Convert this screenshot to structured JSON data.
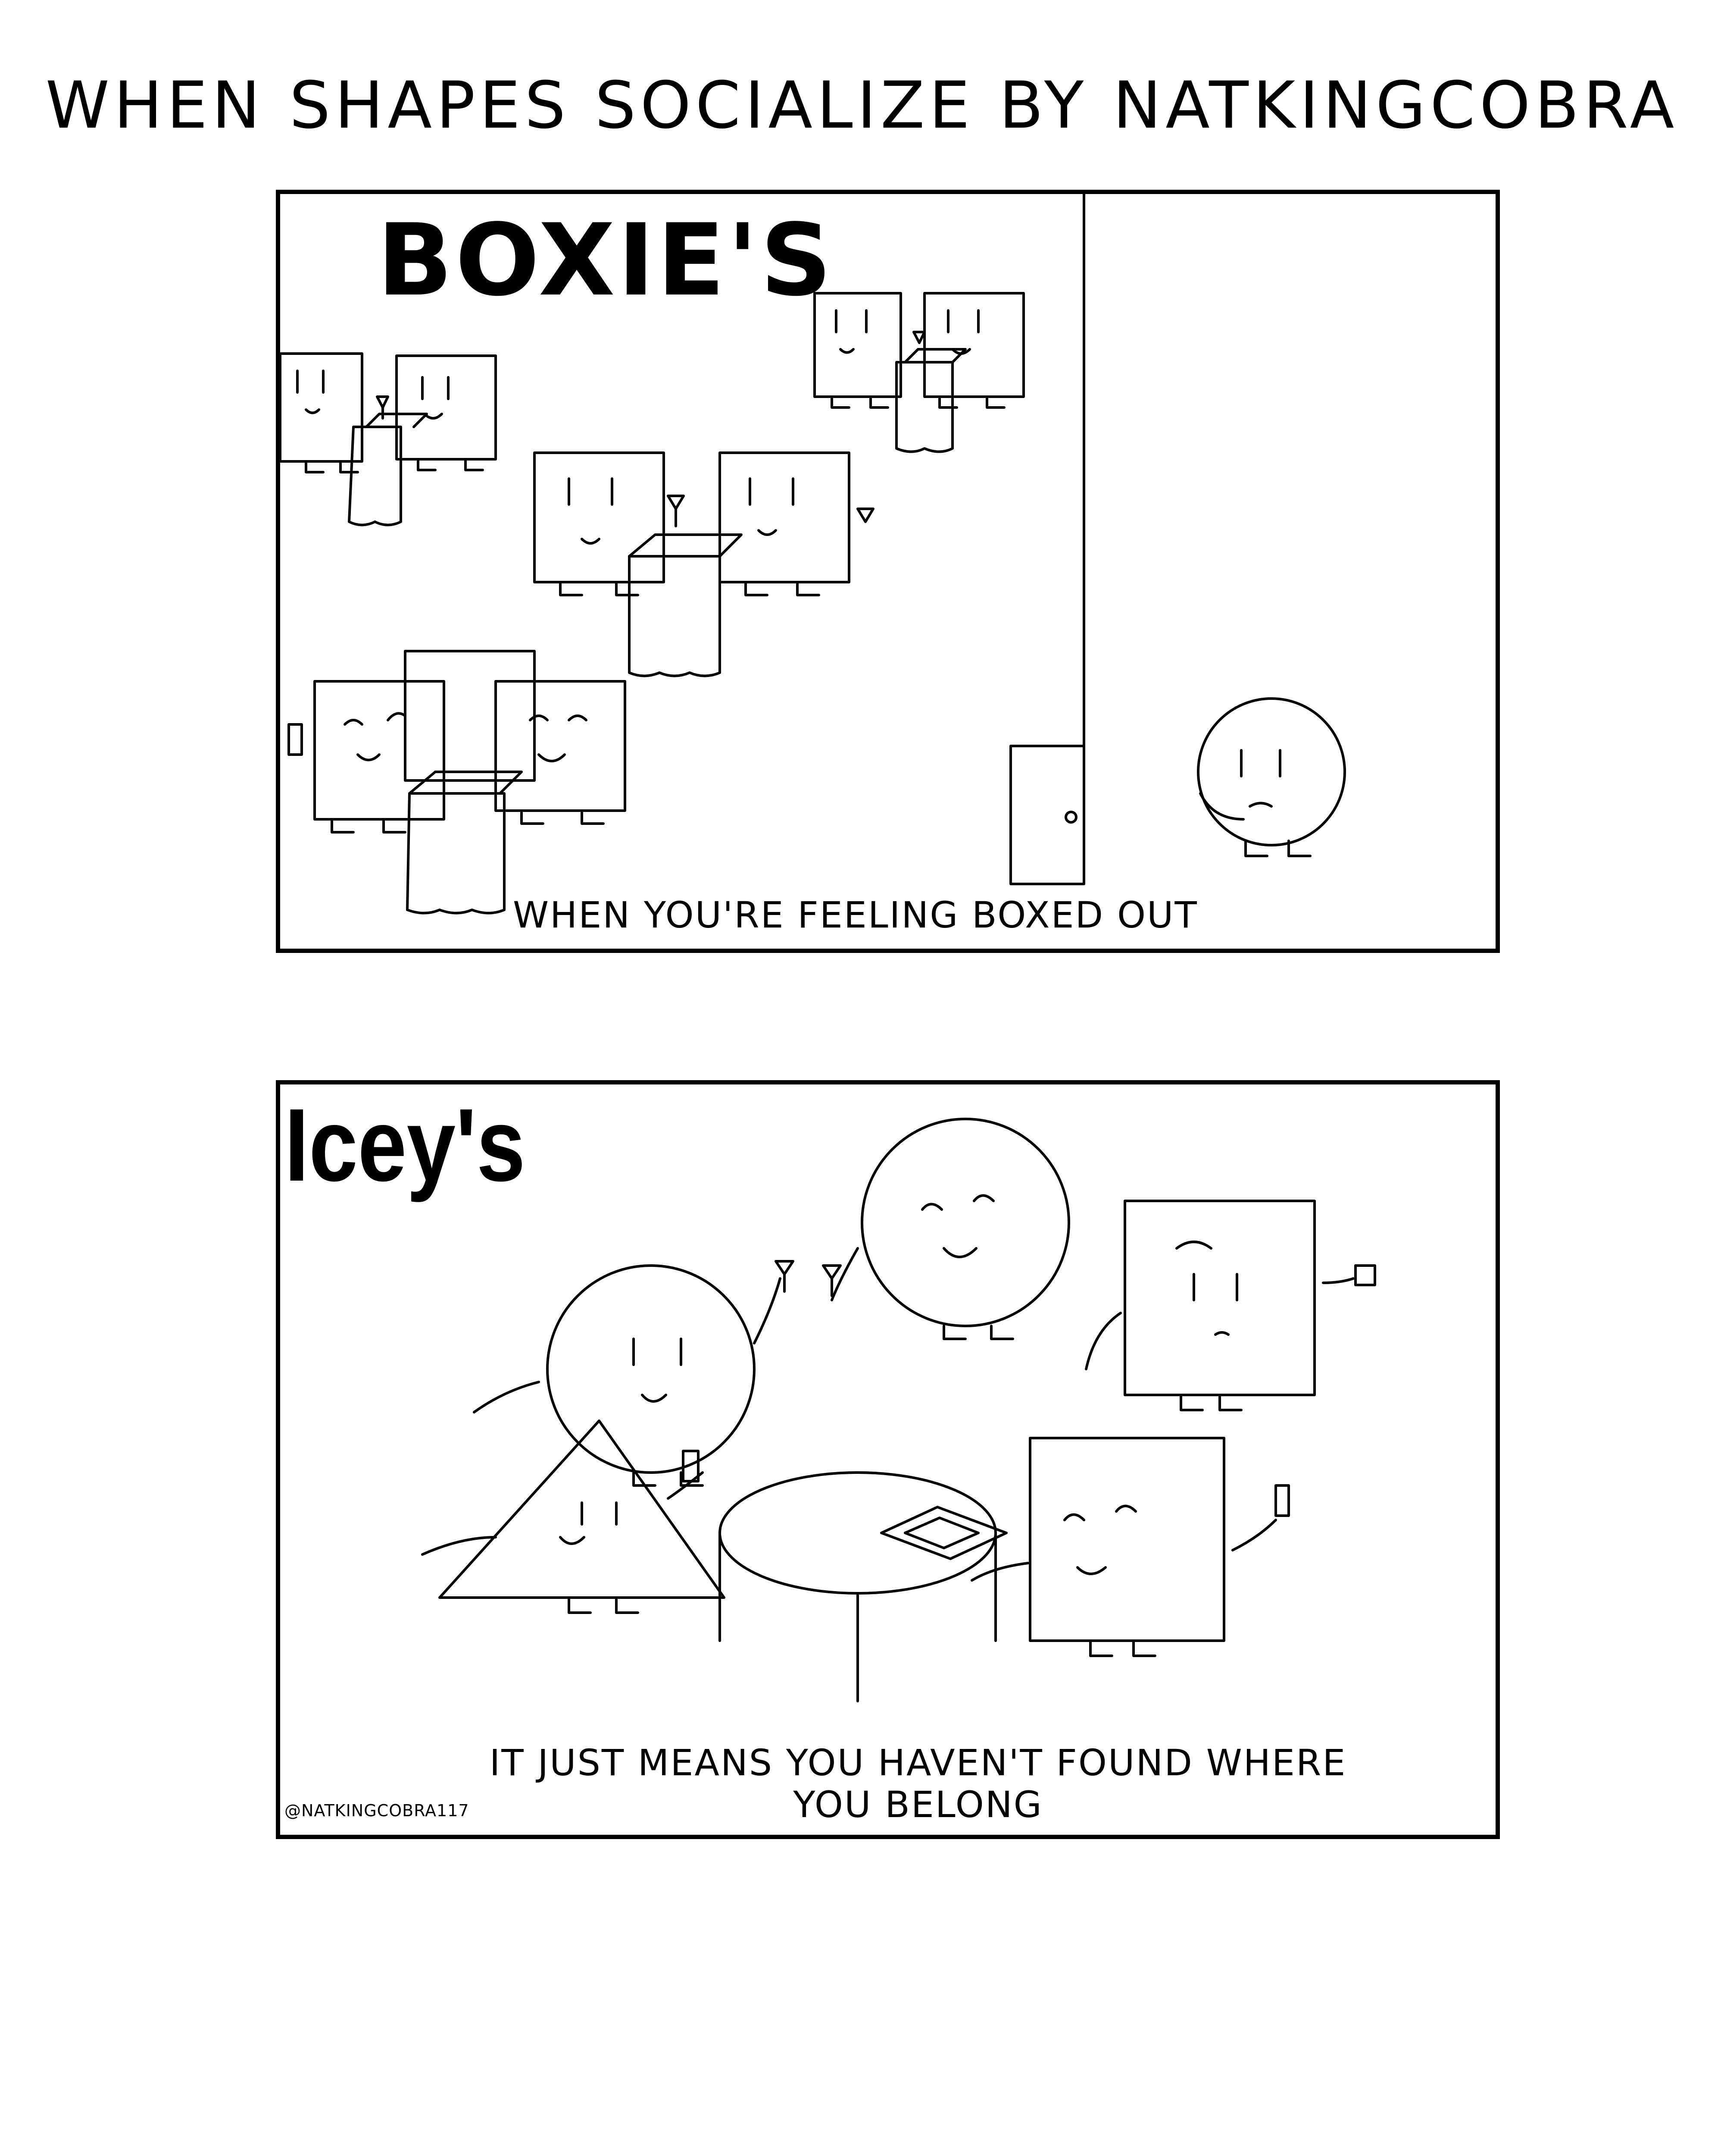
{
  "title": "WHEN SHAPES SOCIALIZE BY NATKINGCOBRA",
  "panel1": {
    "venue_sign": "BOXIE'S",
    "caption": "WHEN YOU'RE FEELING BOXED OUT"
  },
  "panel2": {
    "venue_sign": "Icey's",
    "caption_line1": "IT JUST MEANS YOU HAVEN'T FOUND WHERE",
    "caption_line2": "YOU BELONG",
    "artist_handle": "@NATKINGCOBRA117"
  }
}
